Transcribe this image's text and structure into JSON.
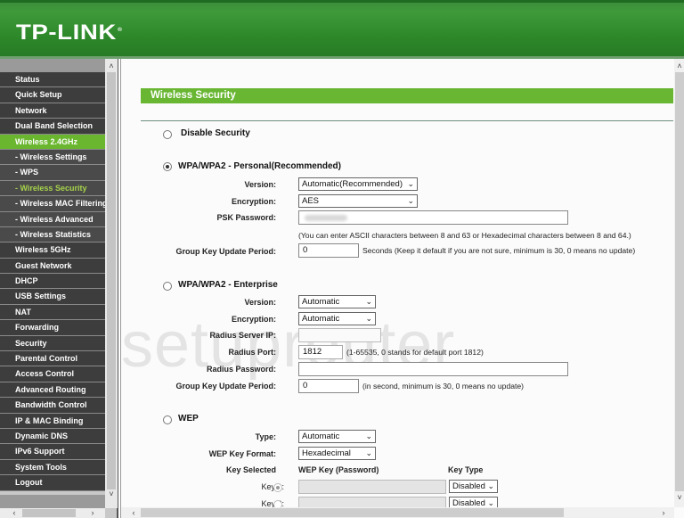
{
  "header": {
    "logo": "TP-LINK",
    "logo_mark": "®"
  },
  "sidebar": {
    "items": [
      {
        "label": "Status",
        "type": "main"
      },
      {
        "label": "Quick Setup",
        "type": "main"
      },
      {
        "label": "Network",
        "type": "main"
      },
      {
        "label": "Dual Band Selection",
        "type": "main"
      },
      {
        "label": "Wireless 2.4GHz",
        "type": "active"
      },
      {
        "label": "- Wireless Settings",
        "type": "sub"
      },
      {
        "label": "- WPS",
        "type": "sub"
      },
      {
        "label": "- Wireless Security",
        "type": "current"
      },
      {
        "label": "- Wireless MAC Filtering",
        "type": "sub"
      },
      {
        "label": "- Wireless Advanced",
        "type": "sub"
      },
      {
        "label": "- Wireless Statistics",
        "type": "sub"
      },
      {
        "label": "Wireless 5GHz",
        "type": "main"
      },
      {
        "label": "Guest Network",
        "type": "main"
      },
      {
        "label": "DHCP",
        "type": "main"
      },
      {
        "label": "USB Settings",
        "type": "main"
      },
      {
        "label": "NAT",
        "type": "main"
      },
      {
        "label": "Forwarding",
        "type": "main"
      },
      {
        "label": "Security",
        "type": "main"
      },
      {
        "label": "Parental Control",
        "type": "main"
      },
      {
        "label": "Access Control",
        "type": "main"
      },
      {
        "label": "Advanced Routing",
        "type": "main"
      },
      {
        "label": "Bandwidth Control",
        "type": "main"
      },
      {
        "label": "IP & MAC Binding",
        "type": "main"
      },
      {
        "label": "Dynamic DNS",
        "type": "main"
      },
      {
        "label": "IPv6 Support",
        "type": "main"
      },
      {
        "label": "System Tools",
        "type": "main"
      },
      {
        "label": "Logout",
        "type": "main"
      }
    ]
  },
  "scroll": {
    "up": "˄",
    "down": "˅",
    "left": "‹",
    "right": "›"
  },
  "main": {
    "title": "Wireless Security",
    "watermark": "setuprouter",
    "disable": {
      "label": "Disable Security",
      "checked": false
    },
    "personal": {
      "label": "WPA/WPA2 - Personal(Recommended)",
      "checked": true,
      "version_label": "Version:",
      "version_value": "Automatic(Recommended)",
      "encryption_label": "Encryption:",
      "encryption_value": "AES",
      "psk_label": "PSK Password:",
      "psk_value": "",
      "psk_hint": "(You can enter ASCII characters between 8 and 63 or Hexadecimal characters between 8 and 64.)",
      "group_label": "Group Key Update Period:",
      "group_value": "0",
      "group_hint": "Seconds (Keep it default if you are not sure, minimum is 30, 0 means no update)"
    },
    "enterprise": {
      "label": "WPA/WPA2 - Enterprise",
      "checked": false,
      "version_label": "Version:",
      "version_value": "Automatic",
      "encryption_label": "Encryption:",
      "encryption_value": "Automatic",
      "radius_ip_label": "Radius Server IP:",
      "radius_ip_value": "",
      "radius_port_label": "Radius Port:",
      "radius_port_value": "1812",
      "radius_port_hint": "(1-65535, 0 stands for default port 1812)",
      "radius_password_label": "Radius Password:",
      "radius_password_value": "",
      "group_label": "Group Key Update Period:",
      "group_value": "0",
      "group_hint": "(in second, minimum is 30, 0 means no update)"
    },
    "wep": {
      "label": "WEP",
      "checked": false,
      "type_label": "Type:",
      "type_value": "Automatic",
      "format_label": "WEP Key Format:",
      "format_value": "Hexadecimal",
      "col_key_selected": "Key Selected",
      "col_wep_key": "WEP Key (Password)",
      "col_key_type": "Key Type",
      "keys": [
        {
          "label": "Key 1:",
          "selected": true,
          "value": "",
          "type": "Disabled"
        },
        {
          "label": "Key 2:",
          "selected": false,
          "value": "",
          "type": "Disabled"
        }
      ]
    }
  }
}
